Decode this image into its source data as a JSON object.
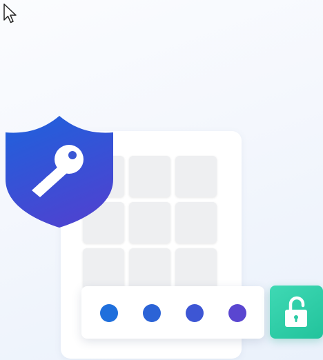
{
  "colors": {
    "pin_dots": [
      "#1f6fdc",
      "#2b63d6",
      "#3d56d4",
      "#5a46d0"
    ],
    "shield_top": "#1e62dc",
    "shield_bottom": "#4a45d1",
    "unlock_button": "#2ccba5"
  },
  "icons": {
    "cursor": "mouse-pointer-icon",
    "shield": "shield-key-icon",
    "unlock": "padlock-open-icon"
  },
  "keypad": {
    "keys": 9
  },
  "pin": {
    "dots": 4
  }
}
